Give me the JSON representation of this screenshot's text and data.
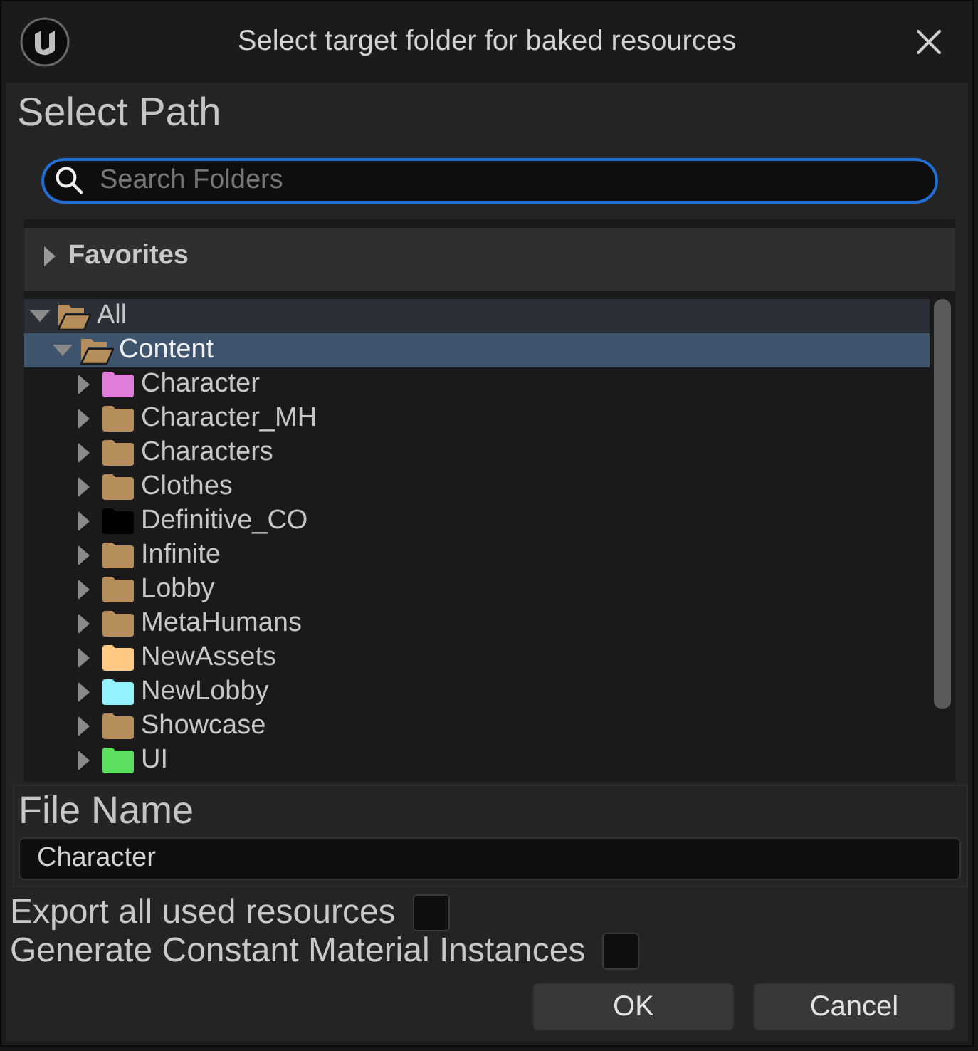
{
  "window": {
    "title": "Select target folder for baked resources"
  },
  "select_path": {
    "heading": "Select Path",
    "search": {
      "placeholder": "Search Folders"
    },
    "favorites": {
      "label": "Favorites",
      "expanded": false
    },
    "tree": [
      {
        "label": "All",
        "expanded": true,
        "selected": false,
        "hovered": true,
        "color": "#b68e5b",
        "children": [
          {
            "label": "Content",
            "expanded": true,
            "selected": true,
            "hovered": false,
            "color": "#b68e5b",
            "children": [
              {
                "label": "Character",
                "expanded": false,
                "selected": false,
                "hovered": false,
                "color": "#e07dd8"
              },
              {
                "label": "Character_MH",
                "expanded": false,
                "selected": false,
                "hovered": false,
                "color": "#b68e5b"
              },
              {
                "label": "Characters",
                "expanded": false,
                "selected": false,
                "hovered": false,
                "color": "#b68e5b"
              },
              {
                "label": "Clothes",
                "expanded": false,
                "selected": false,
                "hovered": false,
                "color": "#b68e5b"
              },
              {
                "label": "Definitive_CO",
                "expanded": false,
                "selected": false,
                "hovered": false,
                "color": "#000000"
              },
              {
                "label": "Infinite",
                "expanded": false,
                "selected": false,
                "hovered": false,
                "color": "#b68e5b"
              },
              {
                "label": "Lobby",
                "expanded": false,
                "selected": false,
                "hovered": false,
                "color": "#b68e5b"
              },
              {
                "label": "MetaHumans",
                "expanded": false,
                "selected": false,
                "hovered": false,
                "color": "#b68e5b"
              },
              {
                "label": "NewAssets",
                "expanded": false,
                "selected": false,
                "hovered": false,
                "color": "#ffc983"
              },
              {
                "label": "NewLobby",
                "expanded": false,
                "selected": false,
                "hovered": false,
                "color": "#93f2ff"
              },
              {
                "label": "Showcase",
                "expanded": false,
                "selected": false,
                "hovered": false,
                "color": "#b68e5b"
              },
              {
                "label": "UI",
                "expanded": false,
                "selected": false,
                "hovered": false,
                "color": "#5ddf5f"
              }
            ]
          }
        ]
      }
    ]
  },
  "file_name": {
    "label": "File Name",
    "value": "Character"
  },
  "options": [
    {
      "label": "Export all used resources",
      "checked": false
    },
    {
      "label": "Generate Constant Material Instances",
      "checked": false
    }
  ],
  "buttons": [
    "OK",
    "Cancel"
  ]
}
